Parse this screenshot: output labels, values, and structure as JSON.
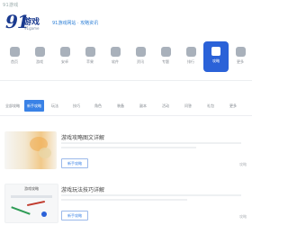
{
  "top_note": "91游戏",
  "header": {
    "logo_number": "91",
    "logo_name": "游戏",
    "logo_sub": "91game",
    "slogan": "91游戏网站 · 攻略资讯"
  },
  "nav": {
    "items": [
      {
        "label": "首页",
        "icon": "home-icon"
      },
      {
        "label": "游戏",
        "icon": "gamepad-icon"
      },
      {
        "label": "安卓",
        "icon": "android-icon"
      },
      {
        "label": "苹果",
        "icon": "apple-icon"
      },
      {
        "label": "软件",
        "icon": "apps-icon"
      },
      {
        "label": "资讯",
        "icon": "news-icon"
      },
      {
        "label": "专题",
        "icon": "topic-icon"
      },
      {
        "label": "排行",
        "icon": "rank-icon"
      },
      {
        "label": "攻略",
        "icon": "guide-icon",
        "active": true
      },
      {
        "label": "更多",
        "icon": "more-icon"
      }
    ]
  },
  "tabs": [
    {
      "label": "全部攻略"
    },
    {
      "label": "新手攻略",
      "active": true
    },
    {
      "label": "玩法"
    },
    {
      "label": "技巧"
    },
    {
      "label": "角色"
    },
    {
      "label": "装备"
    },
    {
      "label": "副本"
    },
    {
      "label": "活动"
    },
    {
      "label": "问答"
    },
    {
      "label": "礼包"
    },
    {
      "label": "更多"
    }
  ],
  "articles": [
    {
      "title": "游戏攻略图文详解",
      "tag": "新手攻略",
      "date": "攻略"
    },
    {
      "title": "游戏玩法技巧详解",
      "thumb_title": "游戏攻略",
      "tag": "新手攻略",
      "date": "攻略"
    }
  ],
  "colors": {
    "brand": "#1a3a8f",
    "accent": "#2b62d8",
    "tab_active": "#3a82e6"
  }
}
